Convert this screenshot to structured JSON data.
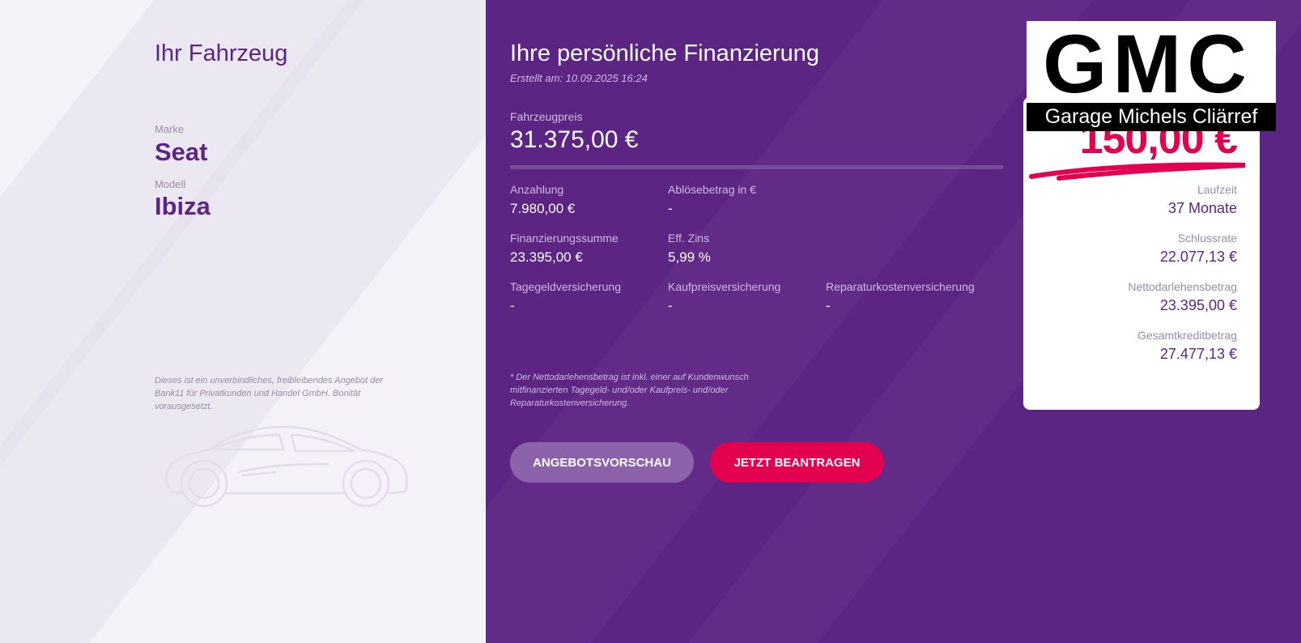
{
  "vehicle": {
    "title": "Ihr Fahrzeug",
    "make_label": "Marke",
    "make": "Seat",
    "model_label": "Modell",
    "model": "Ibiza",
    "disclaimer": "Dieses ist ein unverbindliches, freibleibendes Angebot der Bank11 für Privatkunden und Handel GmbH. Bonität vorausgesetzt."
  },
  "financing": {
    "title": "Ihre persönliche Finanzierung",
    "created": "Erstellt am: 10.09.2025 16:24",
    "price_label": "Fahrzeugpreis",
    "price": "31.375,00 €",
    "down_payment_label": "Anzahlung",
    "down_payment": "7.980,00 €",
    "payoff_label": "Ablösebetrag in €",
    "payoff": "-",
    "financing_sum_label": "Finanzierungssumme",
    "financing_sum": "23.395,00 €",
    "interest_label": "Eff. Zins",
    "interest": "5,99 %",
    "daily_insurance_label": "Tagegeldversicherung",
    "daily_insurance": "-",
    "purchase_insurance_label": "Kaufpreisversicherung",
    "purchase_insurance": "-",
    "repair_insurance_label": "Reparaturkostenversicherung",
    "repair_insurance": "-",
    "footnote": "* Der Nettodarlehensbetrag ist inkl. einer auf Kundenwunsch mitfinanzierten Tagegeld- und/oder Kaufpreis- und/oder Reparaturkostenversicherung."
  },
  "buttons": {
    "preview": "ANGEBOTSVORSCHAU",
    "apply": "JETZT BEANTRAGEN"
  },
  "summary": {
    "rate": "150,00 €",
    "term_label": "Laufzeit",
    "term": "37 Monate",
    "final_rate_label": "Schlussrate",
    "final_rate": "22.077,13 €",
    "net_loan_label": "Nettodarlehensbetrag",
    "net_loan": "23.395,00 €",
    "total_credit_label": "Gesamtkreditbetrag",
    "total_credit": "27.477,13 €"
  },
  "logo": {
    "mark": "GMC",
    "subtitle": "Garage Michels Cliärref"
  },
  "colors": {
    "brand_purple": "#5c2483",
    "accent_pink": "#e2004f",
    "light_bg": "#f4f2f8"
  }
}
